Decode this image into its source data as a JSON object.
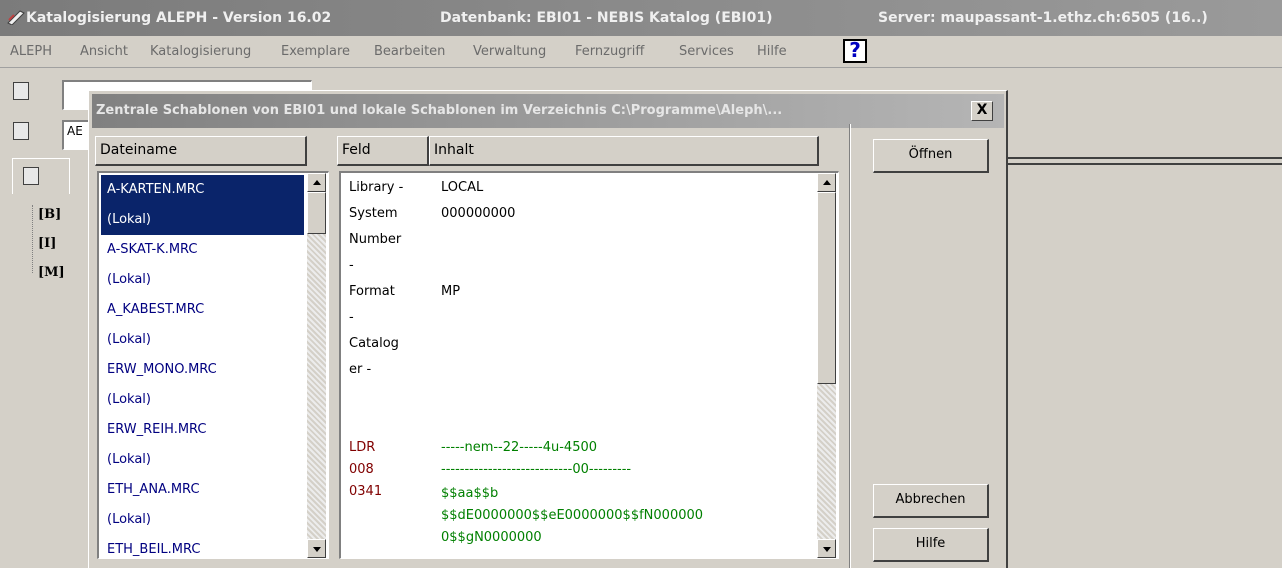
{
  "window": {
    "title": "Katalogisierung ALEPH - Version 16.02",
    "database": "Datenbank: EBI01 - NEBIS Katalog (EBI01)",
    "server": "Server: maupassant-1.ethz.ch:6505 (16..)"
  },
  "menu": {
    "items": [
      "ALEPH",
      "Ansicht",
      "Katalogisierung",
      "Exemplare",
      "Bearbeiten",
      "Verwaltung",
      "Fernzugriff",
      "Services",
      "Hilfe"
    ],
    "help_icon": "?"
  },
  "background": {
    "field_value": "AE",
    "tree": [
      "[B]",
      "[I]",
      "[M]"
    ]
  },
  "dialog": {
    "title": "Zentrale Schablonen von EBI01 und lokale Schablonen im Verzeichnis C:\\Programme\\Aleph\\...",
    "close": "X",
    "files_header": "Dateiname",
    "files": [
      {
        "name": "A-KARTEN.MRC",
        "loc": "(Lokal)",
        "selected": true
      },
      {
        "name": "A-SKAT-K.MRC",
        "loc": "(Lokal)",
        "selected": false
      },
      {
        "name": "A_KABEST.MRC",
        "loc": "(Lokal)",
        "selected": false
      },
      {
        "name": "ERW_MONO.MRC",
        "loc": "(Lokal)",
        "selected": false
      },
      {
        "name": "ERW_REIH.MRC",
        "loc": "(Lokal)",
        "selected": false
      },
      {
        "name": "ETH_ANA.MRC",
        "loc": "(Lokal)",
        "selected": false
      },
      {
        "name": "ETH_BEIL.MRC",
        "loc": "",
        "selected": false
      }
    ],
    "col_feld": "Feld",
    "col_inhalt": "Inhalt",
    "header_rows": [
      {
        "label": "Library -",
        "value": "LOCAL"
      },
      {
        "label": "System",
        "value": "000000000"
      },
      {
        "label": "Number",
        "value": ""
      },
      {
        "label": "-",
        "value": ""
      },
      {
        "label": "Format",
        "value": "MP"
      },
      {
        "label": "-",
        "value": ""
      },
      {
        "label": "Catalog",
        "value": ""
      },
      {
        "label": "er -",
        "value": ""
      }
    ],
    "marc_fields": [
      {
        "tag": "LDR",
        "content": "-----nem--22-----4u-4500"
      },
      {
        "tag": "008",
        "content": "----------------------------00---------"
      },
      {
        "tag": "0341",
        "content": "$$aa$$b"
      },
      {
        "tag": "",
        "content": "$$dE0000000$$eE0000000$$fN000000"
      },
      {
        "tag": "",
        "content": "0$$gN0000000"
      }
    ],
    "buttons": {
      "open": "Öffnen",
      "cancel": "Abbrechen",
      "help": "Hilfe"
    }
  },
  "colors": {
    "selection": "#0a246a",
    "file_text": "#000080",
    "marc_tag": "#800000",
    "marc_content": "#008000"
  }
}
